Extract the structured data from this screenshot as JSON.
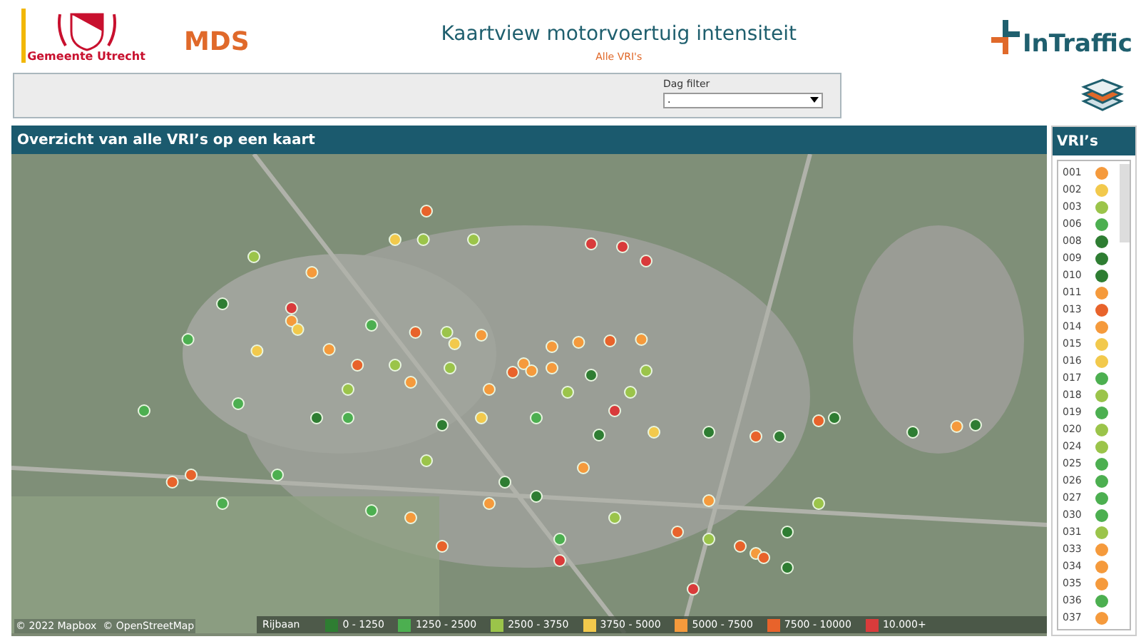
{
  "header": {
    "org_name": "Gemeente Utrecht",
    "app_name": "MDS",
    "title": "Kaartview motorvoertuig intensiteit",
    "subtitle": "Alle VRI's",
    "brand": "InTraffic"
  },
  "filter": {
    "label": "Dag filter",
    "value": "."
  },
  "map_panel": {
    "title": "Overzicht van alle VRI’s op een kaart",
    "attribution": "© 2022 Mapbox  © OpenStreetMap",
    "legend": {
      "title": "Rijbaan",
      "items": [
        {
          "label": "0 - 1250",
          "color": "#2e7d32"
        },
        {
          "label": "1250 - 2500",
          "color": "#4caf50"
        },
        {
          "label": "2500 - 3750",
          "color": "#9bc44a"
        },
        {
          "label": "3750 - 5000",
          "color": "#f2c94c"
        },
        {
          "label": "5000 - 7500",
          "color": "#f59a3c"
        },
        {
          "label": "7500 - 10000",
          "color": "#e8632b"
        },
        {
          "label": "10.000+",
          "color": "#d93b3b"
        }
      ]
    }
  },
  "vri_panel": {
    "title": "VRI’s",
    "items": [
      {
        "label": "001",
        "color": "#f59a3c"
      },
      {
        "label": "002",
        "color": "#f2c94c"
      },
      {
        "label": "003",
        "color": "#9bc44a"
      },
      {
        "label": "006",
        "color": "#4caf50"
      },
      {
        "label": "008",
        "color": "#2e7d32"
      },
      {
        "label": "009",
        "color": "#2e7d32"
      },
      {
        "label": "010",
        "color": "#2e7d32"
      },
      {
        "label": "011",
        "color": "#f59a3c"
      },
      {
        "label": "013",
        "color": "#e8632b"
      },
      {
        "label": "014",
        "color": "#f59a3c"
      },
      {
        "label": "015",
        "color": "#f2c94c"
      },
      {
        "label": "016",
        "color": "#f2c94c"
      },
      {
        "label": "017",
        "color": "#4caf50"
      },
      {
        "label": "018",
        "color": "#9bc44a"
      },
      {
        "label": "019",
        "color": "#4caf50"
      },
      {
        "label": "020",
        "color": "#9bc44a"
      },
      {
        "label": "024",
        "color": "#9bc44a"
      },
      {
        "label": "025",
        "color": "#4caf50"
      },
      {
        "label": "026",
        "color": "#4caf50"
      },
      {
        "label": "027",
        "color": "#4caf50"
      },
      {
        "label": "030",
        "color": "#4caf50"
      },
      {
        "label": "031",
        "color": "#9bc44a"
      },
      {
        "label": "033",
        "color": "#f59a3c"
      },
      {
        "label": "034",
        "color": "#f59a3c"
      },
      {
        "label": "035",
        "color": "#f59a3c"
      },
      {
        "label": "036",
        "color": "#4caf50"
      },
      {
        "label": "037",
        "color": "#f59a3c"
      }
    ]
  }
}
